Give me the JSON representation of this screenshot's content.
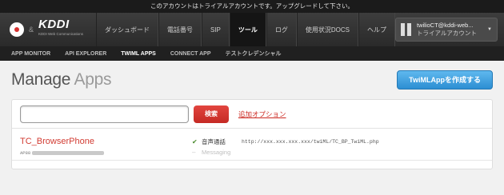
{
  "banner": {
    "text": "このアカウントはトライアルアカウントです。アップグレードして下さい。"
  },
  "logo": {
    "amp": "&",
    "brand": "KDDI",
    "tagline": "KDDI Web Communications"
  },
  "nav": {
    "items": [
      {
        "label": "ダッシュボード"
      },
      {
        "label": "電話番号"
      },
      {
        "label": "SIP"
      },
      {
        "label": "ツール",
        "active": true
      },
      {
        "label": "ログ"
      },
      {
        "label": "使用状況DOCS"
      },
      {
        "label": "ヘルプ"
      }
    ]
  },
  "account": {
    "name": "twilioCT@kddi-web...",
    "type": "トライアルアカウント"
  },
  "subnav": {
    "items": [
      {
        "label": "APP MONITOR"
      },
      {
        "label": "API EXPLORER"
      },
      {
        "label": "TWIML APPS",
        "active": true
      },
      {
        "label": "CONNECT APP"
      },
      {
        "label": "テストクレデンシャル"
      }
    ]
  },
  "page": {
    "title_main": "Manage",
    "title_light": "Apps",
    "create_button": "TwiMLAppを作成する"
  },
  "search": {
    "value": "",
    "placeholder": "",
    "button": "検索",
    "options_link": "追加オプション"
  },
  "apps": [
    {
      "name": "TC_BrowserPhone",
      "sid_prefix": "AP88",
      "voice_label": "音声通話",
      "voice_url": "http://xxx.xxx.xxx.xxx/twiML/TC_BP_TwiML.php",
      "messaging_label": "Messaging"
    }
  ],
  "colors": {
    "accent_red": "#d23b32",
    "button_blue": "#2c8ed3",
    "nav_bg": "#2a2a2a"
  }
}
